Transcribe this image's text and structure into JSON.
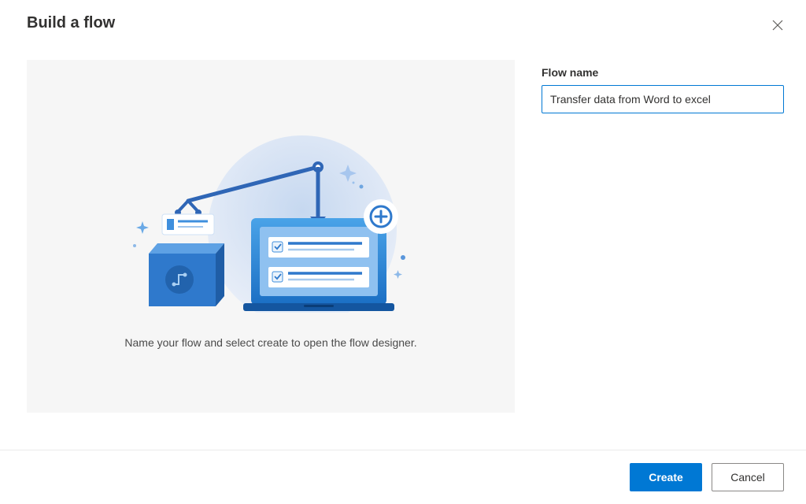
{
  "dialog": {
    "title": "Build a flow",
    "caption": "Name your flow and select create to open the flow designer."
  },
  "form": {
    "flow_name_label": "Flow name",
    "flow_name_value": "Transfer data from Word to excel"
  },
  "buttons": {
    "create": "Create",
    "cancel": "Cancel"
  }
}
